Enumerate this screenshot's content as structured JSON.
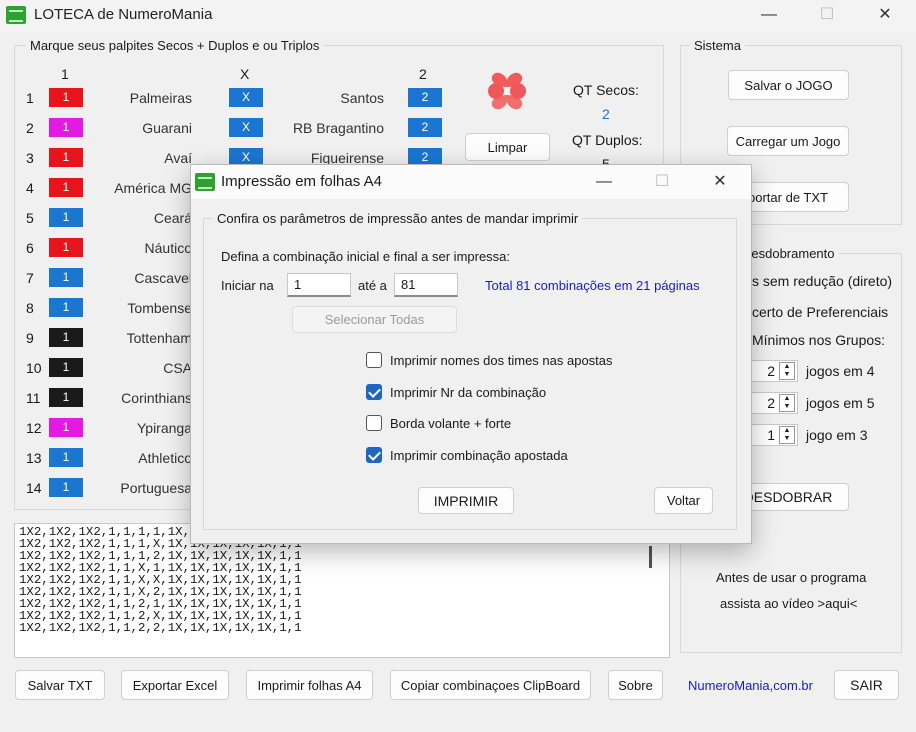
{
  "window": {
    "title": "LOTECA de NumeroMania",
    "min": "—",
    "max": "☐",
    "close": "✕"
  },
  "palpites": {
    "legend": "Marque seus palpites Secos + Duplos e ou Triplos",
    "col1": "1",
    "colx": "X",
    "col2": "2",
    "rows": [
      {
        "n": "1",
        "a": "Palmeiras",
        "b": "Santos",
        "c1": "1",
        "c1c": "#e8141c",
        "x": "X",
        "c2": "2"
      },
      {
        "n": "2",
        "a": "Guarani",
        "b": "RB Bragantino",
        "c1": "1",
        "c1c": "#e21ae2",
        "x": "X",
        "c2": "2"
      },
      {
        "n": "3",
        "a": "Avaí",
        "b": "Figueirense",
        "c1": "1",
        "c1c": "#e8141c",
        "x": "X",
        "c2": "2"
      },
      {
        "n": "4",
        "a": "América MG",
        "b": "",
        "c1": "1",
        "c1c": "#e8141c",
        "x": "",
        "c2": ""
      },
      {
        "n": "5",
        "a": "Ceará",
        "b": "",
        "c1": "1",
        "c1c": "#1b76d2",
        "x": "",
        "c2": ""
      },
      {
        "n": "6",
        "a": "Náutico",
        "b": "",
        "c1": "1",
        "c1c": "#e8141c",
        "x": "",
        "c2": ""
      },
      {
        "n": "7",
        "a": "Cascavel",
        "b": "",
        "c1": "1",
        "c1c": "#1b76d2",
        "x": "",
        "c2": ""
      },
      {
        "n": "8",
        "a": "Tombense",
        "b": "",
        "c1": "1",
        "c1c": "#1b76d2",
        "x": "",
        "c2": ""
      },
      {
        "n": "9",
        "a": "Tottenham",
        "b": "",
        "c1": "1",
        "c1c": "#1a1a1a",
        "x": "",
        "c2": ""
      },
      {
        "n": "10",
        "a": "CSA",
        "b": "",
        "c1": "1",
        "c1c": "#1a1a1a",
        "x": "",
        "c2": ""
      },
      {
        "n": "11",
        "a": "Corinthians",
        "b": "",
        "c1": "1",
        "c1c": "#1a1a1a",
        "x": "",
        "c2": ""
      },
      {
        "n": "12",
        "a": "Ypiranga",
        "b": "",
        "c1": "1",
        "c1c": "#e21ae2",
        "x": "",
        "c2": ""
      },
      {
        "n": "13",
        "a": "Athletico",
        "b": "",
        "c1": "1",
        "c1c": "#1b76d2",
        "x": "",
        "c2": ""
      },
      {
        "n": "14",
        "a": "Portuguesa",
        "b": "",
        "c1": "1",
        "c1c": "#1b76d2",
        "x": "",
        "c2": ""
      }
    ],
    "limpar": "Limpar",
    "qt_secos_label": "QT Secos:",
    "qt_secos_value": "2",
    "qt_duplos_label": "QT Duplos:",
    "qt_duplos_value": "5"
  },
  "sistema": {
    "legend": "Sistema",
    "salvar": "Salvar o JOGO",
    "carregar": "Carregar um Jogo",
    "importar": "portar de TXT"
  },
  "desdobramento": {
    "legend": "Desdobramento",
    "opt1": "s sem redução (direto)",
    "opt2": "certo de Preferenciais",
    "minimos": "Mínimos nos Grupos:",
    "spins": [
      {
        "value": "2",
        "label": "jogos em 4"
      },
      {
        "value": "2",
        "label": "jogos em 5"
      },
      {
        "value": "1",
        "label": "jogo em 3"
      }
    ],
    "desdobrar": "DESDOBRAR",
    "video1": "Antes de usar o programa",
    "video2": "assista ao vídeo >aqui<"
  },
  "output_lines": [
    "1X2,1X2,1X2,1,1,1,1,1X,1X,1X,1X,1X,1,1",
    "1X2,1X2,1X2,1,1,1,X,1X,1X,1X,1X,1X,1,1",
    "1X2,1X2,1X2,1,1,1,2,1X,1X,1X,1X,1X,1,1",
    "1X2,1X2,1X2,1,1,X,1,1X,1X,1X,1X,1X,1,1",
    "1X2,1X2,1X2,1,1,X,X,1X,1X,1X,1X,1X,1,1",
    "1X2,1X2,1X2,1,1,X,2,1X,1X,1X,1X,1X,1,1",
    "1X2,1X2,1X2,1,1,2,1,1X,1X,1X,1X,1X,1,1",
    "1X2,1X2,1X2,1,1,2,X,1X,1X,1X,1X,1X,1,1",
    "1X2,1X2,1X2,1,1,2,2,1X,1X,1X,1X,1X,1,1"
  ],
  "bottom": {
    "salvar_txt": "Salvar TXT",
    "exportar_excel": "Exportar Excel",
    "imprimir_a4": "Imprimir folhas A4",
    "copiar": "Copiar combinaçoes ClipBoard",
    "sobre": "Sobre",
    "link": "NumeroMania,com.br",
    "sair": "SAIR"
  },
  "dialog": {
    "title": "Impressão em folhas A4",
    "legend": "Confira os parâmetros de impressão antes de mandar imprimir",
    "instr": "Defina a combinação inicial e final a ser impressa:",
    "iniciar_label": "Iniciar na",
    "iniciar_value": "1",
    "ate_label": "até a",
    "ate_value": "81",
    "total": "Total 81 combinações em 21 páginas",
    "selecionar": "Selecionar Todas",
    "opts": [
      {
        "label": "Imprimir nomes dos times nas apostas",
        "checked": false
      },
      {
        "label": "Imprimir Nr da combinação",
        "checked": true
      },
      {
        "label": "Borda volante + forte",
        "checked": false
      },
      {
        "label": "Imprimir combinação apostada",
        "checked": true
      }
    ],
    "imprimir": "IMPRIMIR",
    "voltar": "Voltar"
  },
  "colors": {
    "x_blue": "#1b76d2",
    "link_blue": "#1a1ad6",
    "accent": "#1f66c2"
  }
}
